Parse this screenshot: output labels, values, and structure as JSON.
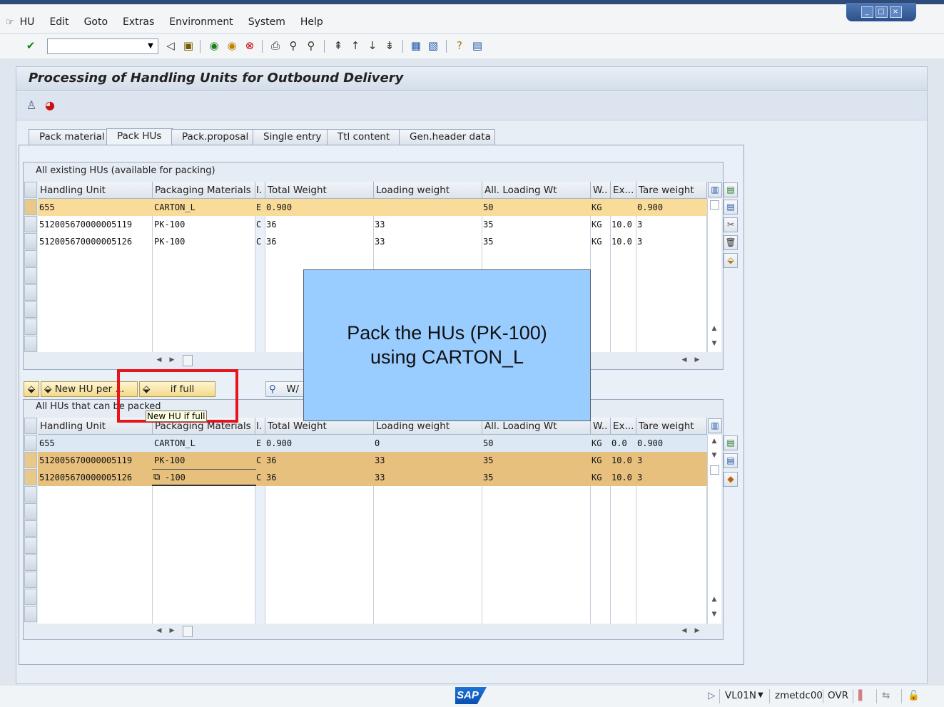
{
  "window": {
    "minimize_glyph": "_",
    "maximize_glyph": "□",
    "close_glyph": "×"
  },
  "menu": {
    "items": [
      "HU",
      "Edit",
      "Goto",
      "Extras",
      "Environment",
      "System",
      "Help"
    ]
  },
  "toolbar": {
    "command_field_value": "",
    "icons": [
      "enter-icon",
      "back-icon",
      "save-icon",
      "back-nav-icon",
      "exit-icon",
      "cancel-icon",
      "print-icon",
      "find-icon",
      "find-next-icon",
      "first-page-icon",
      "prev-page-icon",
      "next-page-icon",
      "last-page-icon",
      "new-session-icon",
      "shortcut-icon",
      "help-icon",
      "layout-icon"
    ]
  },
  "page": {
    "title": "Processing of Handling Units for Outbound Delivery"
  },
  "tabs": [
    "Pack material",
    "Pack HUs",
    "Pack.proposal",
    "Single entry",
    "Ttl content",
    "Gen.header data"
  ],
  "active_tab": "Pack HUs",
  "grid_top": {
    "title": "All existing HUs (available for packing)",
    "columns": [
      "Handling Unit",
      "Packaging Materials",
      "I.",
      "Total Weight",
      "Loading weight",
      "All. Loading Wt",
      "W..",
      "Ex...",
      "Tare weight"
    ],
    "rows": [
      {
        "hu": "655",
        "pm": "CARTON_L",
        "i": "E",
        "tw": "0.900",
        "lw": "",
        "alw": "50",
        "w": "KG",
        "ex": "",
        "tare": "0.900"
      },
      {
        "hu": "512005670000005119",
        "pm": "PK-100",
        "i": "C",
        "tw": "36",
        "lw": "33",
        "alw": "35",
        "w": "KG",
        "ex": "10.0",
        "tare": "3"
      },
      {
        "hu": "512005670000005126",
        "pm": "PK-100",
        "i": "C",
        "tw": "36",
        "lw": "33",
        "alw": "35",
        "w": "KG",
        "ex": "10.0",
        "tare": "3"
      }
    ]
  },
  "buttons": {
    "new_hu_per": "New HU per ...",
    "if_full": "if full",
    "w": "W/"
  },
  "grid_bottom": {
    "title": "All HUs that can be packed",
    "columns": [
      "Handling Unit",
      "Packaging Materials",
      "I.",
      "Total Weight",
      "Loading weight",
      "All. Loading Wt",
      "W..",
      "Ex...",
      "Tare weight"
    ],
    "rows": [
      {
        "hu": "655",
        "pm": "CARTON_L",
        "i": "E",
        "tw": "0.900",
        "lw": "0",
        "alw": "50",
        "w": "KG",
        "ex": "0.0",
        "tare": "0.900"
      },
      {
        "hu": "512005670000005119",
        "pm": "PK-100",
        "i": "C",
        "tw": "36",
        "lw": "33",
        "alw": "35",
        "w": "KG",
        "ex": "10.0",
        "tare": "3"
      },
      {
        "hu": "512005670000005126",
        "pm": "-100",
        "i": "C",
        "tw": "36",
        "lw": "33",
        "alw": "35",
        "w": "KG",
        "ex": "10.0",
        "tare": "3"
      }
    ]
  },
  "tooltip": "New HU if full",
  "callout": {
    "line1": "Pack the HUs (PK-100)",
    "line2": "using CARTON_L"
  },
  "statusbar": {
    "sap_logo": "SAP",
    "transaction": "VL01N",
    "server": "zmetdc00",
    "mode": "OVR"
  },
  "colors": {
    "highlight_row": "#fadc9a",
    "selected_rows": "#e8c07e",
    "callout_bg": "#99ccff",
    "red_box": "#e8131b"
  }
}
